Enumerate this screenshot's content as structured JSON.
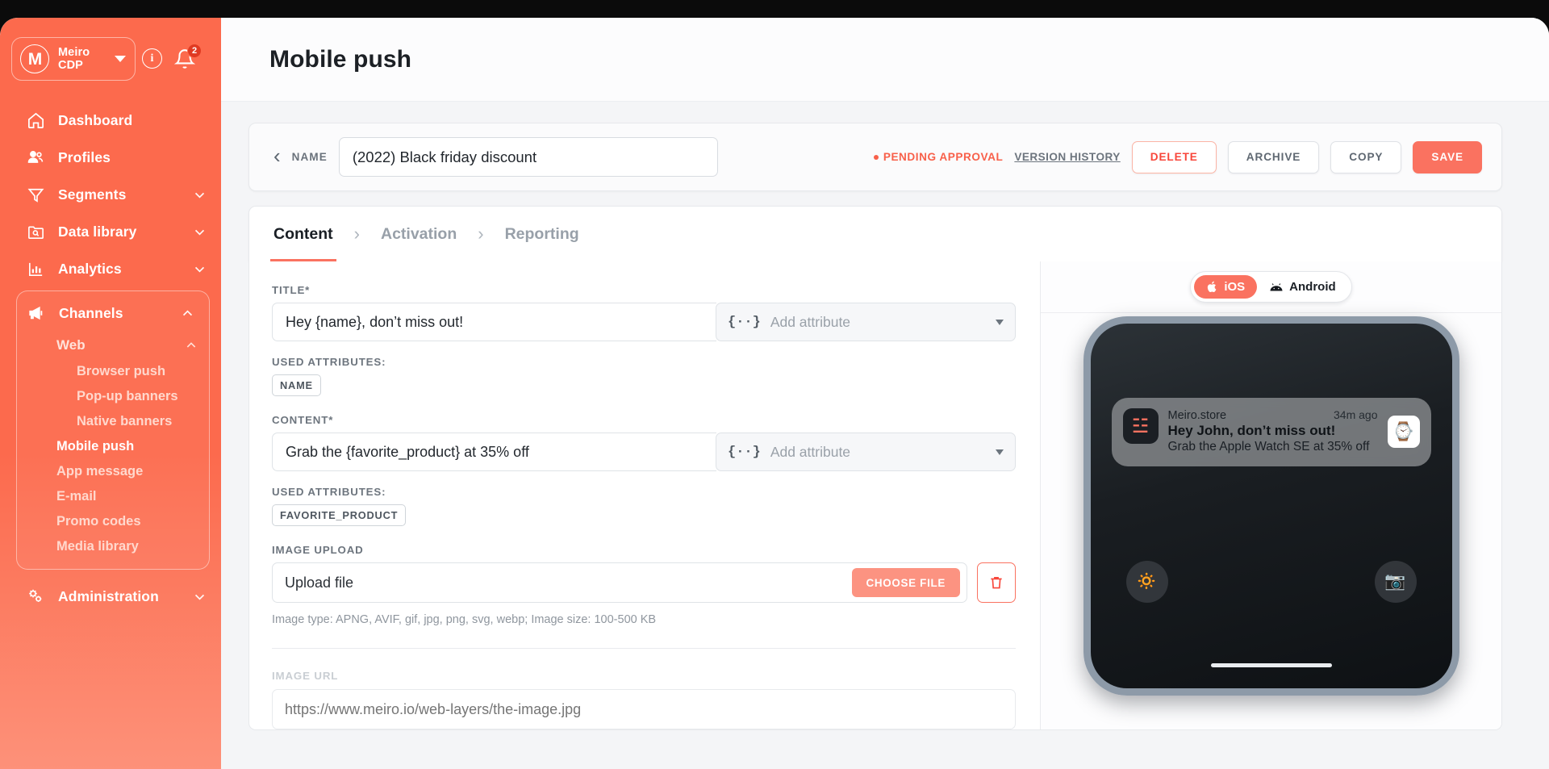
{
  "sidebar": {
    "brand": {
      "logo_letter": "M",
      "name_line1": "Meiro",
      "name_line2": "CDP"
    },
    "info_icon_label": "i",
    "notifications_badge": "2",
    "nav": [
      {
        "label": "Dashboard",
        "icon": "home-icon",
        "expandable": false
      },
      {
        "label": "Profiles",
        "icon": "people-icon",
        "expandable": false
      },
      {
        "label": "Segments",
        "icon": "funnel-icon",
        "expandable": true
      },
      {
        "label": "Data library",
        "icon": "folder-search-icon",
        "expandable": true
      },
      {
        "label": "Analytics",
        "icon": "bar-chart-icon",
        "expandable": true
      }
    ],
    "channels": {
      "label": "Channels",
      "icon": "megaphone-icon",
      "web": {
        "label": "Web"
      },
      "web_children": [
        {
          "label": "Browser push"
        },
        {
          "label": "Pop-up banners"
        },
        {
          "label": "Native banners"
        }
      ],
      "items": [
        {
          "label": "Mobile push",
          "selected": true
        },
        {
          "label": "App message",
          "selected": false
        },
        {
          "label": "E-mail",
          "selected": false
        },
        {
          "label": "Promo codes",
          "selected": false
        },
        {
          "label": "Media library",
          "selected": false
        }
      ]
    },
    "administration": {
      "label": "Administration",
      "icon": "gears-icon"
    }
  },
  "header": {
    "title": "Mobile push"
  },
  "namebar": {
    "back_icon": "chevron-left-icon",
    "name_label": "NAME",
    "name_value": "(2022) Black friday discount",
    "status": "PENDING APPROVAL",
    "version_history": "VERSION HISTORY",
    "delete": "DELETE",
    "archive": "ARCHIVE",
    "copy": "COPY",
    "save": "SAVE"
  },
  "tabs": [
    {
      "label": "Content",
      "active": true
    },
    {
      "label": "Activation",
      "active": false
    },
    {
      "label": "Reporting",
      "active": false
    }
  ],
  "form": {
    "title_label": "TITLE*",
    "title_value": "Hey {name}, don’t miss out!",
    "attribute_placeholder": "Add attribute",
    "attribute_brace": "{··}",
    "used_attributes_label": "USED ATTRIBUTES:",
    "title_used_attributes": [
      "NAME"
    ],
    "content_label": "CONTENT*",
    "content_value": "Grab the {favorite_product} at 35% off",
    "content_used_attributes": [
      "FAVORITE_PRODUCT"
    ],
    "image_upload_label": "IMAGE UPLOAD",
    "upload_placeholder": "Upload file",
    "choose_file": "CHOOSE FILE",
    "delete_icon": "trash-icon",
    "image_hint": "Image type: APNG, AVIF, gif, jpg, png, svg, webp; Image size: 100-500 KB",
    "image_url_label": "IMAGE URL",
    "image_url_placeholder": "https://www.meiro.io/web-layers/the-image.jpg"
  },
  "preview": {
    "os_ios": "iOS",
    "os_android": "Android",
    "ios_icon": "apple-icon",
    "android_icon": "android-icon",
    "notification": {
      "app": "Meiro.store",
      "time": "34m ago",
      "title": "Hey John, don’t miss out!",
      "text": "Grab the Apple Watch SE at 35% off",
      "app_icon": "meiro-logo-icon",
      "thumb_icon": "apple-watch-thumbnail"
    },
    "lock_left_icon": "flashlight-icon",
    "lock_right_icon": "camera-icon"
  },
  "colors": {
    "accent": "#fa7260",
    "sidebar": "#fc6a4d",
    "danger": "#f8463a",
    "muted": "#6d757e"
  }
}
